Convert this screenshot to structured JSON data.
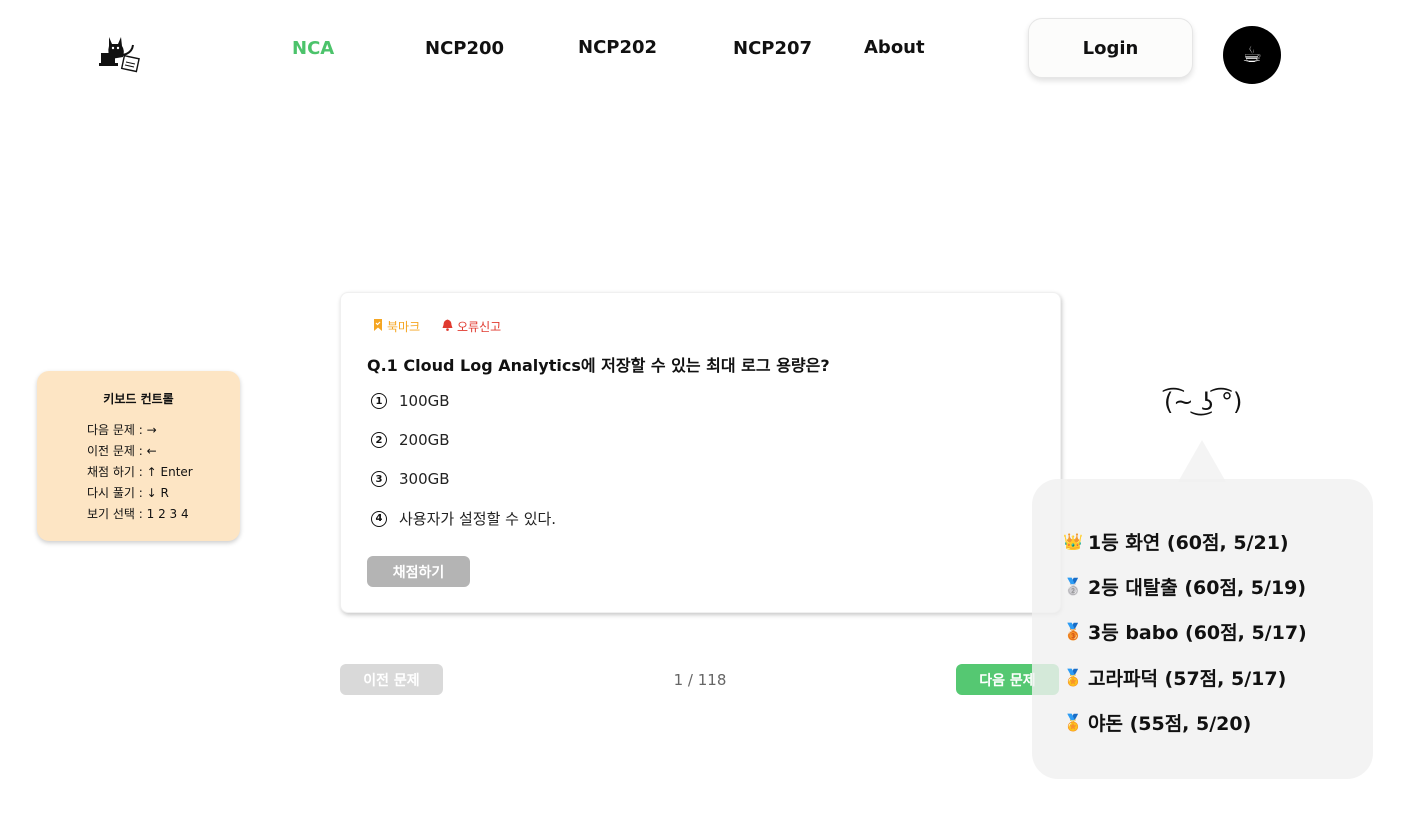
{
  "header": {
    "logo_icon": "cat-laptop-logo-icon",
    "nav": [
      {
        "label": "NCA",
        "active": true
      },
      {
        "label": "NCP200",
        "active": false
      },
      {
        "label": "NCP202",
        "active": false
      },
      {
        "label": "NCP207",
        "active": false
      },
      {
        "label": "About",
        "active": false
      }
    ],
    "login_label": "Login",
    "coffee_icon": "☕"
  },
  "keyboard_panel": {
    "title": "키보드 컨트롤",
    "lines": [
      "다음 문제 : →",
      "이전 문제 : ←",
      "채점 하기 : ↑ Enter",
      "다시 풀기 : ↓ R",
      "보기 선택 : 1 2 3 4"
    ]
  },
  "question": {
    "bookmark_label": "북마크",
    "report_label": "오류신고",
    "title": "Q.1  Cloud Log Analytics에 저장할 수 있는 최대 로그 용량은?",
    "options": [
      {
        "num": "1",
        "text": "100GB"
      },
      {
        "num": "2",
        "text": "200GB"
      },
      {
        "num": "3",
        "text": "300GB"
      },
      {
        "num": "4",
        "text": "사용자가 설정할 수 있다."
      }
    ],
    "grade_label": "채점하기"
  },
  "pagination": {
    "prev_label": "이전 문제",
    "page_text": "1 / 118",
    "next_label": "다음 문제"
  },
  "mascot": "(͡~ ͜ʖ ͡°)",
  "ranking": [
    {
      "medal": "👑",
      "text": "1등  화연 (60점, 5/21)"
    },
    {
      "medal": "🥈",
      "text": "2등  대탈출 (60점, 5/19)"
    },
    {
      "medal": "🥉",
      "text": "3등  babo (60점, 5/17)"
    },
    {
      "medal": "🏅",
      "text": " 고라파덕 (57점, 5/17)"
    },
    {
      "medal": "🏅",
      "text": " 야돈 (55점, 5/20)"
    }
  ],
  "colors": {
    "accent_green": "#4cc36b",
    "bookmark_orange": "#f5a623",
    "report_red": "#e03a2f",
    "keyboard_panel_bg": "#fde5c4"
  }
}
